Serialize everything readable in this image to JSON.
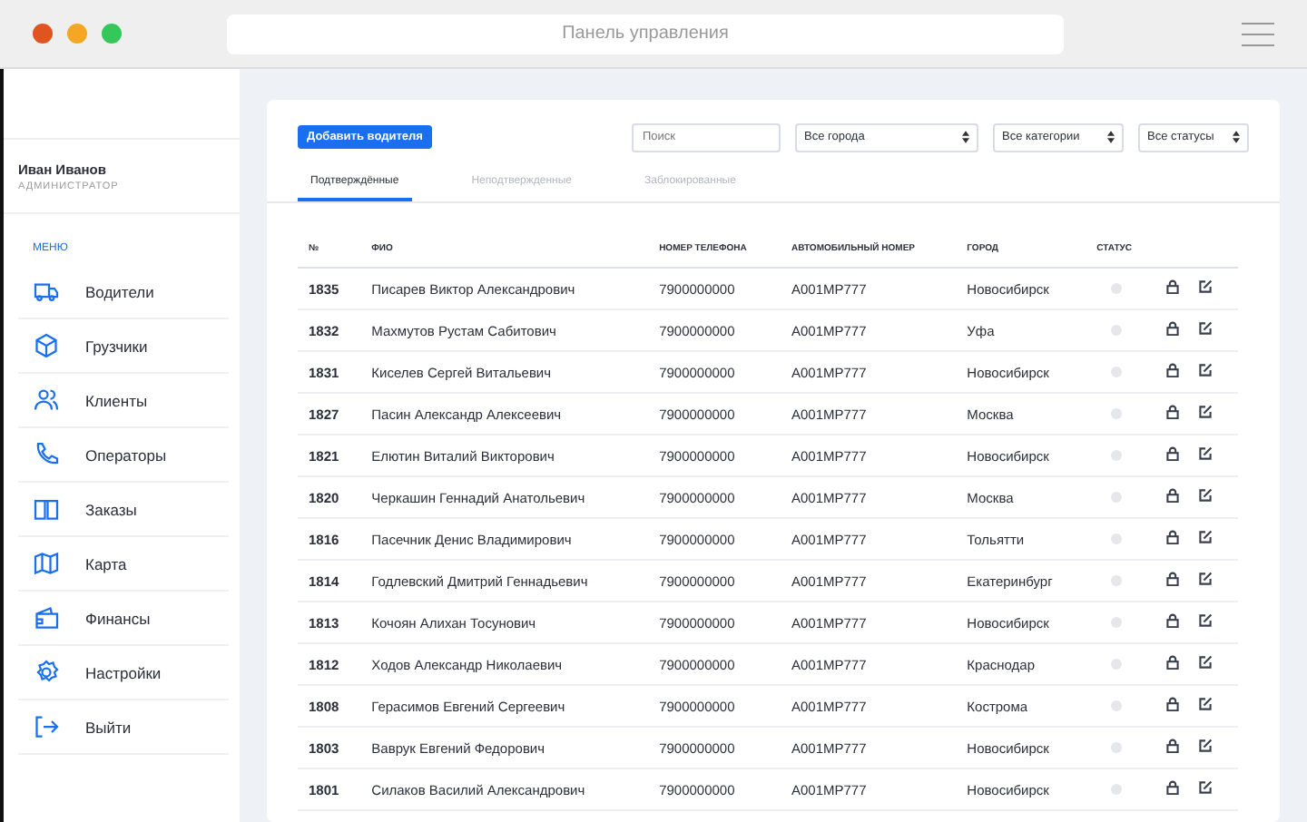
{
  "window": {
    "title": "Панель управления"
  },
  "user": {
    "name": "Иван Иванов",
    "role": "АДМИНИСТРАТОР"
  },
  "sidebar": {
    "heading": "МЕНЮ",
    "items": [
      {
        "label": "Водители",
        "kind": "truck"
      },
      {
        "label": "Грузчики",
        "kind": "box"
      },
      {
        "label": "Клиенты",
        "kind": "users"
      },
      {
        "label": "Операторы",
        "kind": "phone"
      },
      {
        "label": "Заказы",
        "kind": "book"
      },
      {
        "label": "Карта",
        "kind": "map"
      },
      {
        "label": "Финансы",
        "kind": "wallet"
      },
      {
        "label": "Настройки",
        "kind": "gear"
      },
      {
        "label": "Выйти",
        "kind": "logout"
      }
    ]
  },
  "toolbar": {
    "add_button": "Добавить водителя",
    "search": {
      "placeholder": "Поиск"
    },
    "selects": [
      "Все города",
      "Все категории",
      "Все статусы"
    ]
  },
  "tabs": [
    {
      "label": "Подтверждённые",
      "selected": true
    },
    {
      "label": "Неподтвержденные",
      "selected": false
    },
    {
      "label": "Заблокированные",
      "selected": false
    }
  ],
  "table": {
    "columns": [
      "№",
      "ФИО",
      "НОМЕР ТЕЛЕФОНА",
      "АВТОМОБИЛЬНЫЙ НОМЕР",
      "ГОРОД",
      "СТАТУС"
    ],
    "rows": [
      [
        "1835",
        "Писарев Виктор Александрович",
        "7900000000",
        "А001МР777",
        "Новосибирск"
      ],
      [
        "1832",
        "Махмутов Рустам Сабитович",
        "7900000000",
        "А001МР777",
        "Уфа"
      ],
      [
        "1831",
        "Киселев Сергей Витальевич",
        "7900000000",
        "А001МР777",
        "Новосибирск"
      ],
      [
        "1827",
        "Пасин Александр Алексеевич",
        "7900000000",
        "А001МР777",
        "Москва"
      ],
      [
        "1821",
        "Елютин Виталий Викторович",
        "7900000000",
        "А001МР777",
        "Новосибирск"
      ],
      [
        "1820",
        "Черкашин Геннадий Анатольевич",
        "7900000000",
        "А001МР777",
        "Москва"
      ],
      [
        "1816",
        "Пасечник Денис Владимирович",
        "7900000000",
        "А001МР777",
        "Тольятти"
      ],
      [
        "1814",
        "Годлевский Дмитрий Геннадьевич",
        "7900000000",
        "А001МР777",
        "Екатеринбург"
      ],
      [
        "1813",
        "Кочоян Алихан Тосунович",
        "7900000000",
        "А001МР777",
        "Новосибирск"
      ],
      [
        "1812",
        "Ходов Александр Николаевич",
        "7900000000",
        "А001МР777",
        "Краснодар"
      ],
      [
        "1808",
        "Герасимов Евгений Сергеевич",
        "7900000000",
        "А001МР777",
        "Кострома"
      ],
      [
        "1803",
        "Ваврук Евгений Федорович",
        "7900000000",
        "А001МР777",
        "Новосибирск"
      ],
      [
        "1801",
        "Силаков Василий Александрович",
        "7900000000",
        "А001МР777",
        "Новосибирск"
      ]
    ]
  }
}
